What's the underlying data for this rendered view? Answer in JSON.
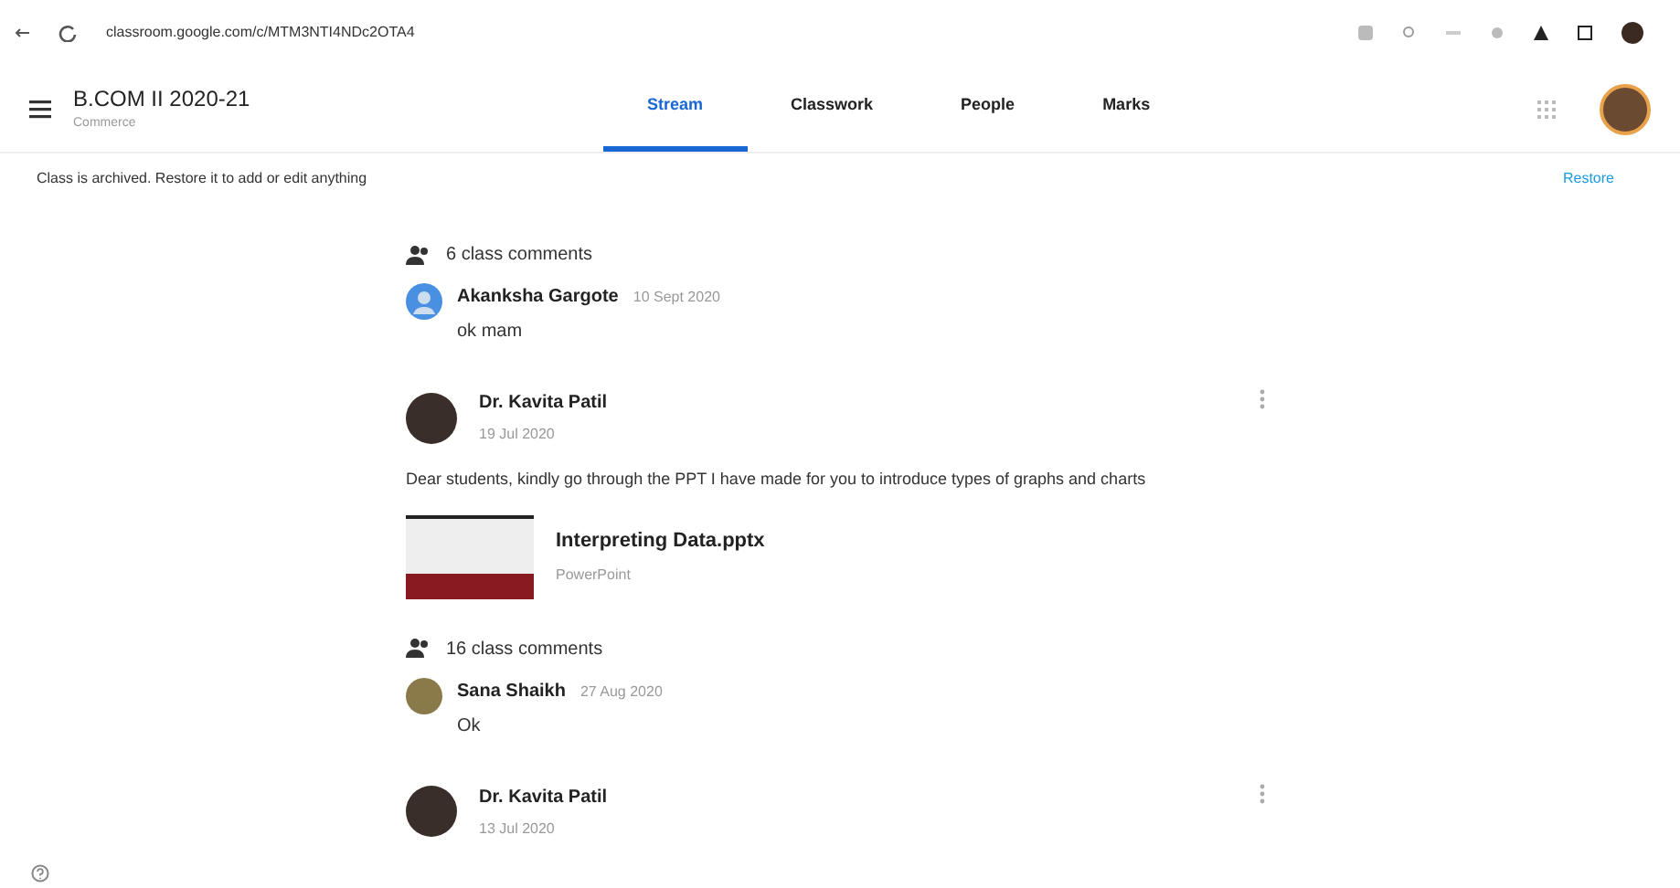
{
  "browser": {
    "url": "classroom.google.com/c/MTM3NTI4NDc2OTA4"
  },
  "header": {
    "class_name": "B.COM II 2020-21",
    "section": "Commerce"
  },
  "tabs": [
    {
      "label": "Stream",
      "selected": true
    },
    {
      "label": "Classwork",
      "selected": false
    },
    {
      "label": "People",
      "selected": false
    },
    {
      "label": "Marks",
      "selected": false
    }
  ],
  "banner": {
    "message": "Class is archived. Restore it to add or edit anything",
    "action": "Restore"
  },
  "stream": [
    {
      "kind": "comments",
      "count_label": "6 class comments",
      "comments": [
        {
          "author": "Akanksha Gargote",
          "date": "10 Sept 2020",
          "text": "ok mam",
          "kind": "generic"
        }
      ]
    },
    {
      "kind": "post",
      "author": "Dr. Kavita Patil",
      "date": "19 Jul 2020",
      "text": "Dear students, kindly go through the PPT I have made for you to introduce types of graphs and charts",
      "attachment": {
        "title": "Interpreting Data.pptx",
        "type": "PowerPoint"
      }
    },
    {
      "kind": "comments",
      "count_label": "16 class comments",
      "comments": [
        {
          "author": "Sana Shaikh",
          "date": "27 Aug 2020",
          "text": "Ok",
          "kind": "photo"
        }
      ]
    },
    {
      "kind": "post",
      "author": "Dr. Kavita Patil",
      "date": "13 Jul 2020"
    }
  ]
}
